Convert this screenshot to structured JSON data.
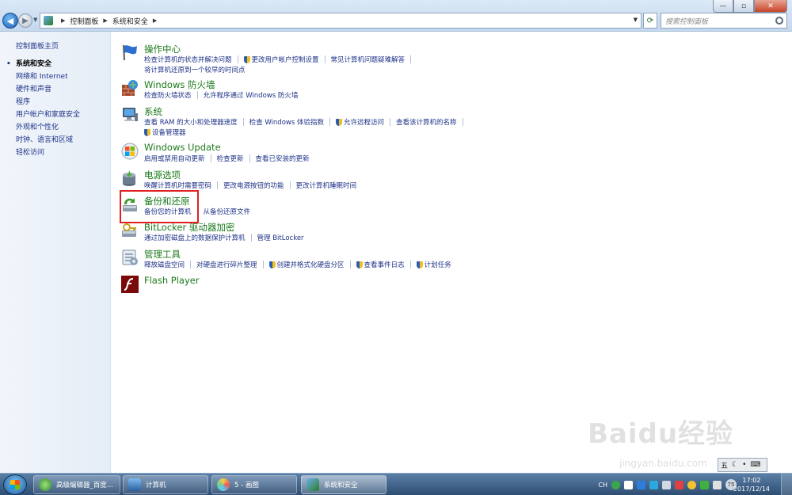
{
  "window": {
    "min_label": "—",
    "max_label": "▫",
    "close_label": "✕"
  },
  "address": {
    "crumbs": [
      "控制面板",
      "系统和安全"
    ]
  },
  "search": {
    "placeholder": "搜索控制面板"
  },
  "left_nav": {
    "home": "控制面板主页",
    "items": [
      {
        "label": "系统和安全",
        "current": true
      },
      {
        "label": "网络和 Internet"
      },
      {
        "label": "硬件和声音"
      },
      {
        "label": "程序"
      },
      {
        "label": "用户帐户和家庭安全"
      },
      {
        "label": "外观和个性化"
      },
      {
        "label": "时钟、语言和区域"
      },
      {
        "label": "轻松访问"
      }
    ]
  },
  "categories": [
    {
      "title": "操作中心",
      "icon": "flag-icon",
      "rows": [
        [
          "检查计算机的状态并解决问题",
          "更改用户帐户控制设置",
          "常见计算机问题疑难解答"
        ],
        [
          "将计算机还原到一个较早的时间点"
        ]
      ]
    },
    {
      "title": "Windows 防火墙",
      "icon": "firewall-icon",
      "rows": [
        [
          "检查防火墙状态",
          "允许程序通过 Windows 防火墙"
        ]
      ]
    },
    {
      "title": "系统",
      "icon": "computer-icon",
      "rows": [
        [
          "查看 RAM 的大小和处理器速度",
          "检查 Windows 体验指数",
          "允许远程访问",
          "查看该计算机的名称"
        ],
        [
          "设备管理器"
        ]
      ]
    },
    {
      "title": "Windows Update",
      "icon": "windows-update-icon",
      "rows": [
        [
          "启用或禁用自动更新",
          "检查更新",
          "查看已安装的更新"
        ]
      ]
    },
    {
      "title": "电源选项",
      "icon": "power-icon",
      "rows": [
        [
          "唤醒计算机时需要密码",
          "更改电源按钮的功能",
          "更改计算机睡眠时间"
        ]
      ]
    },
    {
      "title": "备份和还原",
      "icon": "backup-icon",
      "rows": [
        [
          "备份您的计算机",
          "从备份还原文件"
        ]
      ]
    },
    {
      "title": "BitLocker 驱动器加密",
      "icon": "bitlocker-icon",
      "rows": [
        [
          "通过加密磁盘上的数据保护计算机",
          "管理 BitLocker"
        ]
      ]
    },
    {
      "title": "管理工具",
      "icon": "admin-tools-icon",
      "rows": [
        [
          "释放磁盘空间",
          "对硬盘进行碎片整理",
          "创建并格式化硬盘分区",
          "查看事件日志",
          "计划任务"
        ]
      ]
    },
    {
      "title": "Flash Player",
      "icon": "flash-icon",
      "rows": []
    }
  ],
  "taskbar": {
    "tasks": [
      "高级编辑器_百度...",
      "计算机",
      "5 - 画图",
      "系统和安全"
    ],
    "tray_lang": "CH",
    "clock_time": "17:02",
    "clock_date": "2017/12/14",
    "ime_label": "五",
    "ime_badge": "75"
  },
  "watermark": {
    "main": "Baidu经验",
    "sub": "jingyan.baidu.com"
  },
  "colors": {
    "link": "#1e3287",
    "title_green": "#1a7a1a",
    "highlight": "#e02020"
  }
}
